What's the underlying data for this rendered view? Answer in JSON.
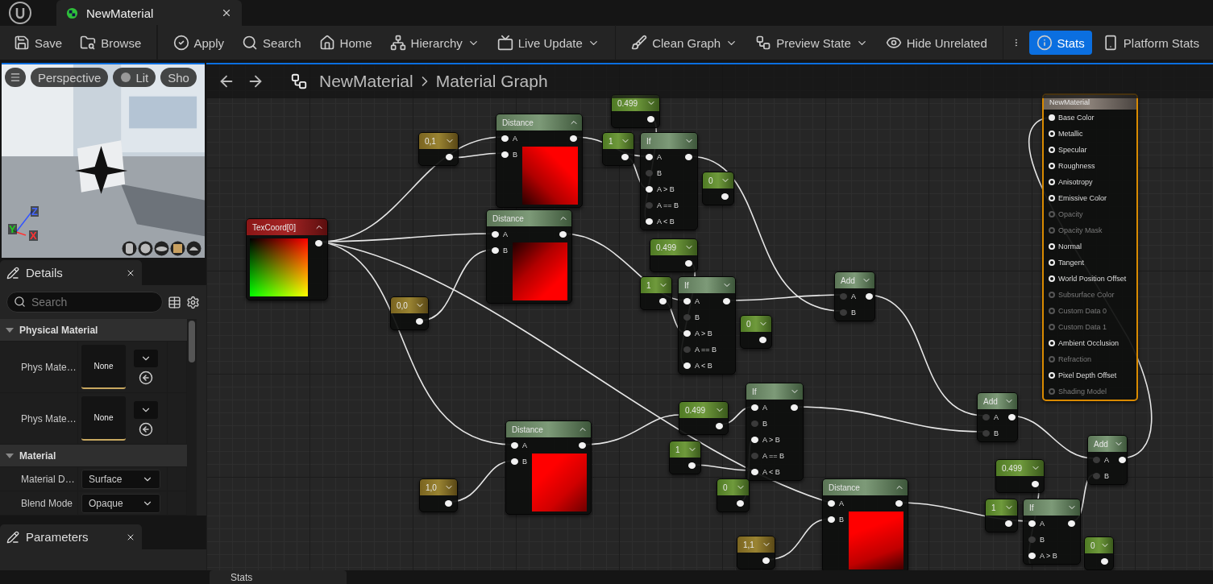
{
  "tab": {
    "title": "NewMaterial"
  },
  "toolbar": [
    {
      "label": "Save",
      "dropdown": false,
      "selected": false
    },
    {
      "label": "Browse",
      "dropdown": false,
      "selected": false
    },
    {
      "label": "Apply",
      "dropdown": false,
      "selected": false
    },
    {
      "label": "Search",
      "dropdown": false,
      "selected": false
    },
    {
      "label": "Home",
      "dropdown": false,
      "selected": false
    },
    {
      "label": "Hierarchy",
      "dropdown": true,
      "selected": false
    },
    {
      "label": "Live Update",
      "dropdown": true,
      "selected": false
    },
    {
      "label": "Clean Graph",
      "dropdown": true,
      "selected": false
    },
    {
      "label": "Preview State",
      "dropdown": true,
      "selected": false
    },
    {
      "label": "Hide Unrelated",
      "dropdown": false,
      "selected": false
    },
    {
      "label": "Stats",
      "dropdown": false,
      "selected": true
    },
    {
      "label": "Platform Stats",
      "dropdown": false,
      "selected": false
    }
  ],
  "viewport": {
    "buttons": [
      "Perspective",
      "Lit",
      "Sho"
    ],
    "axes": [
      "Z",
      "Y",
      "X"
    ]
  },
  "details": {
    "title": "Details",
    "search": {
      "placeholder": "Search"
    },
    "sections": [
      {
        "title": "Physical Material",
        "expanded": true,
        "rows": [
          {
            "kind": "asset",
            "label": "Phys Mate…",
            "value": "None"
          },
          {
            "kind": "asset",
            "label": "Phys Mate…",
            "value": "None"
          }
        ]
      },
      {
        "title": "Material",
        "expanded": true,
        "rows": [
          {
            "kind": "dropdown",
            "label": "Material D…",
            "value": "Surface"
          },
          {
            "kind": "dropdown",
            "label": "Blend Mode",
            "value": "Opaque"
          }
        ]
      }
    ]
  },
  "parameters": {
    "title": "Parameters"
  },
  "bottom_tab": {
    "title": "Stats"
  },
  "graph": {
    "breadcrumb": [
      "NewMaterial",
      "Material Graph"
    ],
    "nodes": [
      {
        "kind": "vector",
        "value": "0,1"
      },
      {
        "kind": "distance",
        "title": "Distance",
        "pins": [
          {
            "label": "A",
            "connected": true
          },
          {
            "label": "B",
            "connected": true
          }
        ]
      },
      {
        "kind": "scalar",
        "value": "0.499"
      },
      {
        "kind": "scalar",
        "value": "1"
      },
      {
        "kind": "if",
        "title": "If",
        "pins": [
          {
            "label": "A",
            "connected": true
          },
          {
            "label": "B",
            "connected": false
          },
          {
            "label": "A > B",
            "connected": true
          },
          {
            "label": "A == B",
            "connected": false
          },
          {
            "label": "A < B",
            "connected": true
          }
        ]
      },
      {
        "kind": "scalar",
        "value": "0"
      },
      {
        "kind": "texcoord",
        "title": "TexCoord[0]"
      },
      {
        "kind": "distance",
        "title": "Distance",
        "pins": [
          {
            "label": "A",
            "connected": true
          },
          {
            "label": "B",
            "connected": true
          }
        ]
      },
      {
        "kind": "vector",
        "value": "0,0"
      },
      {
        "kind": "scalar",
        "value": "0.499"
      },
      {
        "kind": "scalar",
        "value": "1"
      },
      {
        "kind": "if",
        "title": "If",
        "pins": [
          {
            "label": "A",
            "connected": true
          },
          {
            "label": "B",
            "connected": false
          },
          {
            "label": "A > B",
            "connected": true
          },
          {
            "label": "A == B",
            "connected": false
          },
          {
            "label": "A < B",
            "connected": true
          }
        ]
      },
      {
        "kind": "scalar",
        "value": "0"
      },
      {
        "kind": "add",
        "title": "Add",
        "pins": [
          {
            "label": "A",
            "connected": false
          },
          {
            "label": "B",
            "connected": false
          }
        ]
      },
      {
        "kind": "result",
        "title": "NewMaterial",
        "pins": [
          {
            "label": "Base Color",
            "connected": true,
            "enabled": true
          },
          {
            "label": "Metallic",
            "connected": false,
            "enabled": true
          },
          {
            "label": "Specular",
            "connected": false,
            "enabled": true
          },
          {
            "label": "Roughness",
            "connected": false,
            "enabled": true
          },
          {
            "label": "Anisotropy",
            "connected": false,
            "enabled": true
          },
          {
            "label": "Emissive Color",
            "connected": false,
            "enabled": true
          },
          {
            "label": "Opacity",
            "connected": false,
            "enabled": false
          },
          {
            "label": "Opacity Mask",
            "connected": false,
            "enabled": false
          },
          {
            "label": "Normal",
            "connected": false,
            "enabled": true
          },
          {
            "label": "Tangent",
            "connected": false,
            "enabled": true
          },
          {
            "label": "World Position Offset",
            "connected": false,
            "enabled": true
          },
          {
            "label": "Subsurface Color",
            "connected": false,
            "enabled": false
          },
          {
            "label": "Custom Data 0",
            "connected": false,
            "enabled": false
          },
          {
            "label": "Custom Data 1",
            "connected": false,
            "enabled": false
          },
          {
            "label": "Ambient Occlusion",
            "connected": false,
            "enabled": true
          },
          {
            "label": "Refraction",
            "connected": false,
            "enabled": false
          },
          {
            "label": "Pixel Depth Offset",
            "connected": false,
            "enabled": true
          },
          {
            "label": "Shading Model",
            "connected": false,
            "enabled": false
          }
        ]
      },
      {
        "kind": "scalar",
        "value": "0.499"
      },
      {
        "kind": "scalar",
        "value": "1"
      },
      {
        "kind": "if",
        "title": "If",
        "pins": [
          {
            "label": "A",
            "connected": true
          },
          {
            "label": "B",
            "connected": false
          },
          {
            "label": "A > B",
            "connected": true
          },
          {
            "label": "A == B",
            "connected": false
          },
          {
            "label": "A < B",
            "connected": true
          }
        ]
      },
      {
        "kind": "scalar",
        "value": "0"
      },
      {
        "kind": "distance",
        "title": "Distance",
        "pins": [
          {
            "label": "A",
            "connected": true
          },
          {
            "label": "B",
            "connected": true
          }
        ]
      },
      {
        "kind": "vector",
        "value": "1,0"
      },
      {
        "kind": "add",
        "title": "Add",
        "pins": [
          {
            "label": "A",
            "connected": false
          },
          {
            "label": "B",
            "connected": false
          }
        ]
      },
      {
        "kind": "add",
        "title": "Add",
        "pins": [
          {
            "label": "A",
            "connected": false
          },
          {
            "label": "B",
            "connected": false
          }
        ]
      },
      {
        "kind": "scalar",
        "value": "0.499"
      },
      {
        "kind": "distance",
        "title": "Distance",
        "pins": [
          {
            "label": "A",
            "connected": true
          },
          {
            "label": "B",
            "connected": true
          }
        ]
      },
      {
        "kind": "scalar",
        "value": "1"
      },
      {
        "kind": "if",
        "title": "If",
        "pins": [
          {
            "label": "A",
            "connected": true
          },
          {
            "label": "B",
            "connected": false
          },
          {
            "label": "A > B",
            "connected": true
          }
        ]
      },
      {
        "kind": "scalar",
        "value": "0"
      },
      {
        "kind": "vector",
        "value": "1,1"
      }
    ]
  }
}
